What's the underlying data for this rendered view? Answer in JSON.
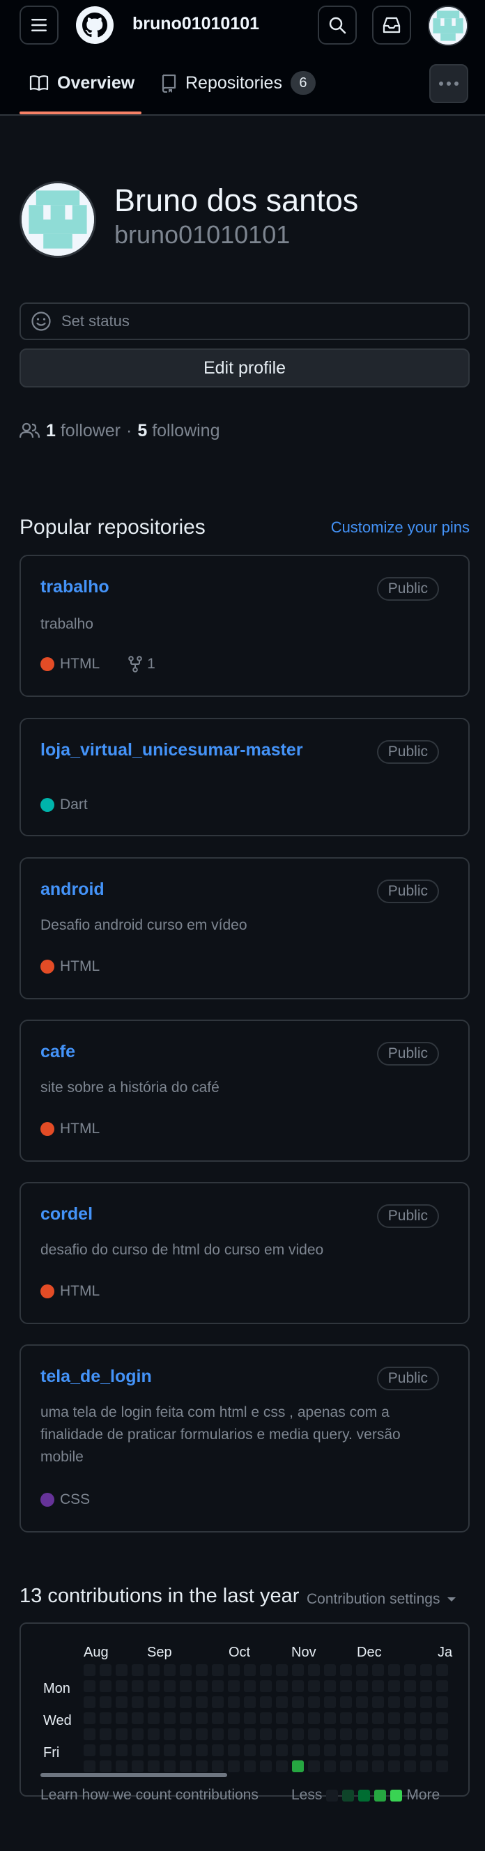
{
  "header": {
    "username": "bruno01010101"
  },
  "tabs": [
    {
      "label": "Overview"
    },
    {
      "label": "Repositories",
      "count": "6"
    }
  ],
  "profile": {
    "fullname": "Bruno dos santos",
    "login": "bruno01010101",
    "set_status": "Set status",
    "edit_profile": "Edit profile",
    "followers_count": "1",
    "followers_label": "follower",
    "separator": "·",
    "following_count": "5",
    "following_label": "following"
  },
  "popular": {
    "title": "Popular repositories",
    "customize": "Customize your pins",
    "repos": [
      {
        "name": "trabalho",
        "badge": "Public",
        "desc": "trabalho",
        "lang": "HTML",
        "color": "#e34c26",
        "forks": "1"
      },
      {
        "name": "loja_virtual_unicesumar-master",
        "badge": "Public",
        "desc": "",
        "lang": "Dart",
        "color": "#00B4AB"
      },
      {
        "name": "android",
        "badge": "Public",
        "desc": "Desafio android curso em vídeo",
        "lang": "HTML",
        "color": "#e34c26"
      },
      {
        "name": "cafe",
        "badge": "Public",
        "desc": "site sobre a história do café",
        "lang": "HTML",
        "color": "#e34c26"
      },
      {
        "name": "cordel",
        "badge": "Public",
        "desc": "desafio do curso de html do curso em video",
        "lang": "HTML",
        "color": "#e34c26"
      },
      {
        "name": "tela_de_login",
        "badge": "Public",
        "desc": "uma tela de login feita com html e css , apenas com a finalidade de praticar formularios e media query. versão mobile",
        "lang": "CSS",
        "color": "#663399"
      }
    ]
  },
  "contributions": {
    "title": "13 contributions in the last year",
    "settings": "Contribution settings",
    "months": [
      "Aug",
      "Sep",
      "Oct",
      "Nov",
      "Dec",
      "Ja"
    ],
    "days": [
      "Mon",
      "Wed",
      "Fri"
    ],
    "learn": "Learn how we count contributions",
    "less": "Less",
    "more": "More",
    "colors": {
      "empty": "#161b22",
      "level1": "#0e4429",
      "level2": "#006d32",
      "level3": "#26a641",
      "level4": "#39d353"
    }
  }
}
